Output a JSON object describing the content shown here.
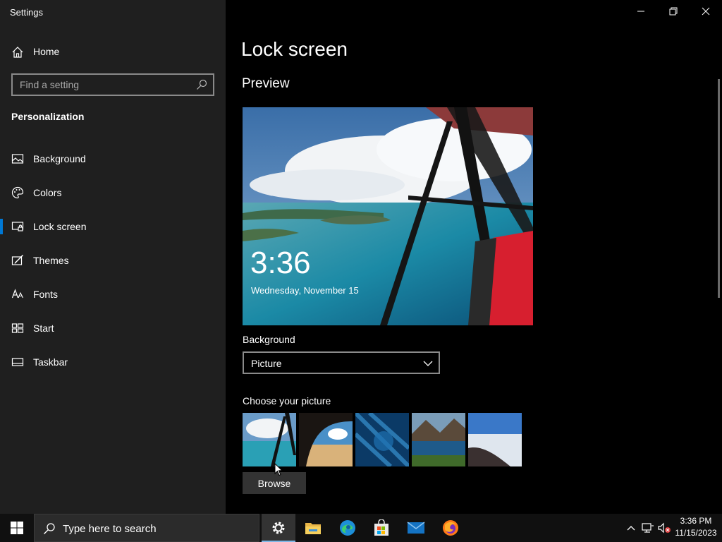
{
  "window": {
    "title": "Settings"
  },
  "sidebar": {
    "home_label": "Home",
    "search_placeholder": "Find a setting",
    "section_title": "Personalization",
    "items": [
      {
        "label": "Background",
        "icon": "image-icon"
      },
      {
        "label": "Colors",
        "icon": "palette-icon"
      },
      {
        "label": "Lock screen",
        "icon": "lock-screen-icon",
        "active": true
      },
      {
        "label": "Themes",
        "icon": "brush-icon"
      },
      {
        "label": "Fonts",
        "icon": "font-icon"
      },
      {
        "label": "Start",
        "icon": "start-tiles-icon"
      },
      {
        "label": "Taskbar",
        "icon": "taskbar-icon"
      }
    ]
  },
  "main": {
    "title": "Lock screen",
    "preview_title": "Preview",
    "preview_time": "3:36",
    "preview_date": "Wednesday, November 15",
    "background_label": "Background",
    "background_value": "Picture",
    "choose_label": "Choose your picture",
    "browse_label": "Browse"
  },
  "taskbar": {
    "search_placeholder": "Type here to search",
    "time": "3:36 PM",
    "date": "11/15/2023",
    "apps": [
      "settings-icon",
      "file-explorer-icon",
      "edge-icon",
      "store-icon",
      "mail-icon",
      "firefox-icon"
    ]
  },
  "colors": {
    "accent": "#0078d4",
    "sidebar_bg": "#1f1f1f",
    "main_bg": "#000000"
  }
}
